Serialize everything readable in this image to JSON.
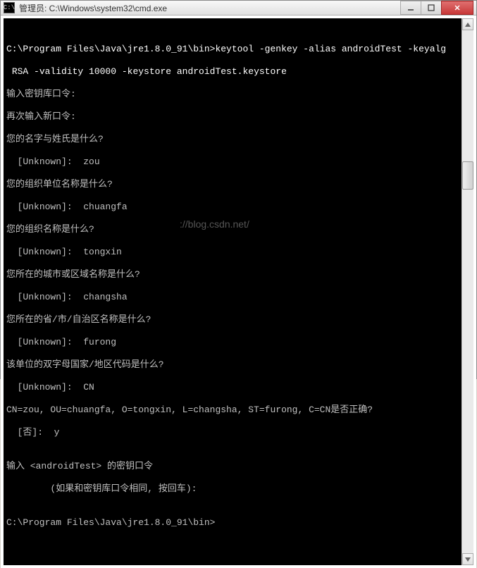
{
  "titlebar": {
    "icon_label": "C:\\",
    "title": "管理员: C:\\Windows\\system32\\cmd.exe"
  },
  "console": {
    "blank0": "",
    "cmd1": "C:\\Program Files\\Java\\jre1.8.0_91\\bin>keytool -genkey -alias androidTest -keyalg",
    "cmd2": " RSA -validity 10000 -keystore androidTest.keystore",
    "line3": "输入密钥库口令:",
    "line4": "再次输入新口令:",
    "line5": "您的名字与姓氏是什么?",
    "line6": "  [Unknown]:  zou",
    "line7": "您的组织单位名称是什么?",
    "line8": "  [Unknown]:  chuangfa",
    "line9": "您的组织名称是什么?",
    "line10": "  [Unknown]:  tongxin",
    "line11": "您所在的城市或区域名称是什么?",
    "line12": "  [Unknown]:  changsha",
    "line13": "您所在的省/市/自治区名称是什么?",
    "line14": "  [Unknown]:  furong",
    "line15": "该单位的双字母国家/地区代码是什么?",
    "line16": "  [Unknown]:  CN",
    "line17": "CN=zou, OU=chuangfa, O=tongxin, L=changsha, ST=furong, C=CN是否正确?",
    "line18": "  [否]:  y",
    "blank1": "",
    "line19": "输入 <androidTest> 的密钥口令",
    "line20": "        (如果和密钥库口令相同, 按回车):",
    "blank2": "",
    "line21": "C:\\Program Files\\Java\\jre1.8.0_91\\bin>"
  },
  "watermark": "://blog.csdn.net/"
}
